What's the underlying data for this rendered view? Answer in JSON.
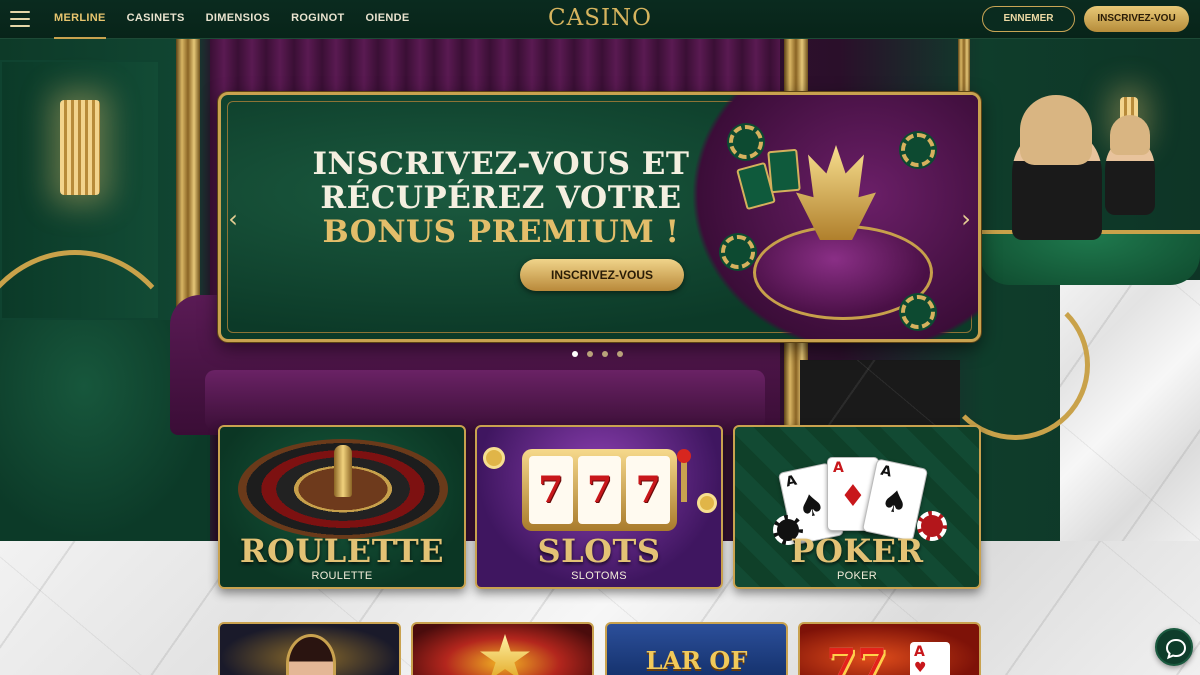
{
  "nav": {
    "links": [
      {
        "label": "MERLINE",
        "active": true
      },
      {
        "label": "CASINETS",
        "active": false
      },
      {
        "label": "DIMENSIOS",
        "active": false
      },
      {
        "label": "ROGINOT",
        "active": false
      },
      {
        "label": "OIENDE",
        "active": false
      }
    ],
    "logo": "CASINO",
    "login_label": "ENNEMER",
    "register_label": "INSCRIVEZ-VOU"
  },
  "banner": {
    "line1": "INSCRIVEZ-VOUS ET",
    "line2": "RÉCUPÉREZ VOTRE",
    "line3": "BONUS PREMIUM !",
    "cta_label": "INSCRIVEZ-VOUS",
    "slides_total": 4,
    "active_slide": 1,
    "prev_icon": "chevron-left-icon",
    "next_icon": "chevron-right-icon"
  },
  "games": [
    {
      "title": "ROULETTE",
      "subtitle": "ROULETTE"
    },
    {
      "title": "SLOTS",
      "subtitle": "SLOTOMS"
    },
    {
      "title": "POKER",
      "subtitle": "POKER"
    }
  ],
  "slots_reels": [
    "7",
    "7",
    "7"
  ],
  "poker_cards": [
    "A",
    "A",
    "A"
  ],
  "thumbnails": [
    {
      "text": ""
    },
    {
      "text": ""
    },
    {
      "text": "LAR OF GOLF"
    },
    {
      "text": "77"
    }
  ],
  "colors": {
    "accent_gold": "#c9a24f",
    "deep_green": "#0b3624",
    "purple": "#3f1660"
  },
  "chat_icon": "chat-bubble-icon"
}
